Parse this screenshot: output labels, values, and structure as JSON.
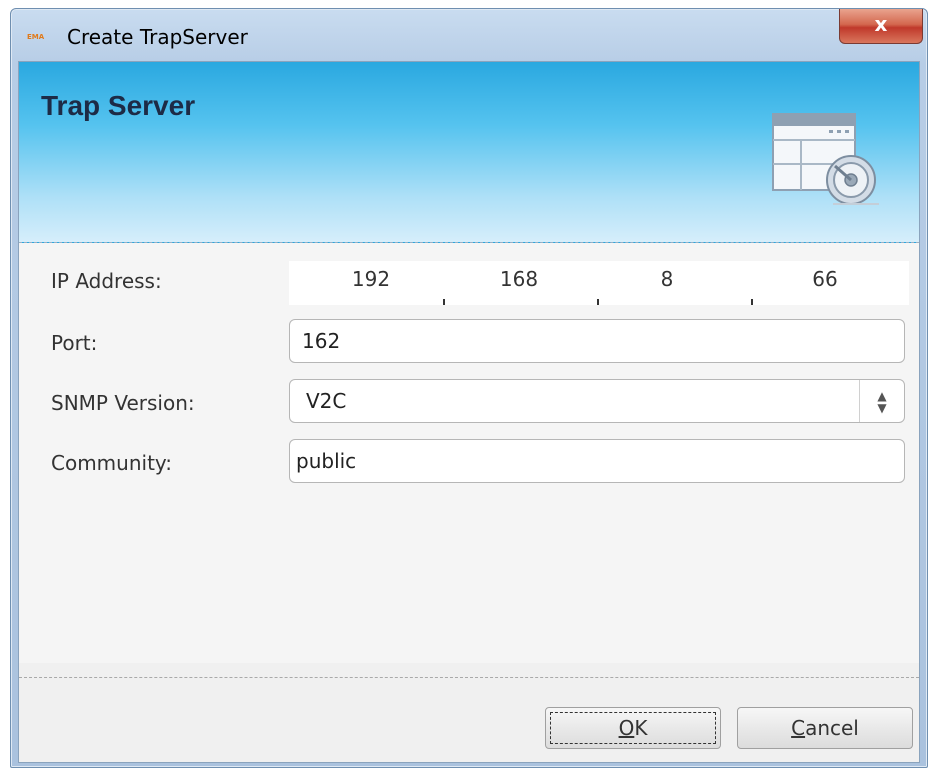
{
  "window": {
    "title": "Create TrapServer",
    "app_icon_text": "EMA",
    "close_label": "x"
  },
  "banner": {
    "title": "Trap Server",
    "icon": "server-settings-icon"
  },
  "form": {
    "ip_label": "IP Address:",
    "ip_octets": [
      "192",
      "168",
      "8",
      "66"
    ],
    "port_label": "Port:",
    "port_value": "162",
    "snmp_label": "SNMP Version:",
    "snmp_value": "V2C",
    "community_label": "Community:",
    "community_value": "public"
  },
  "buttons": {
    "ok_first": "O",
    "ok_rest": "K",
    "cancel_first": "C",
    "cancel_rest": "ancel"
  },
  "colors": {
    "banner_top": "#2aa8e0",
    "banner_bottom": "#d6eefb",
    "close_red": "#c0392b"
  }
}
